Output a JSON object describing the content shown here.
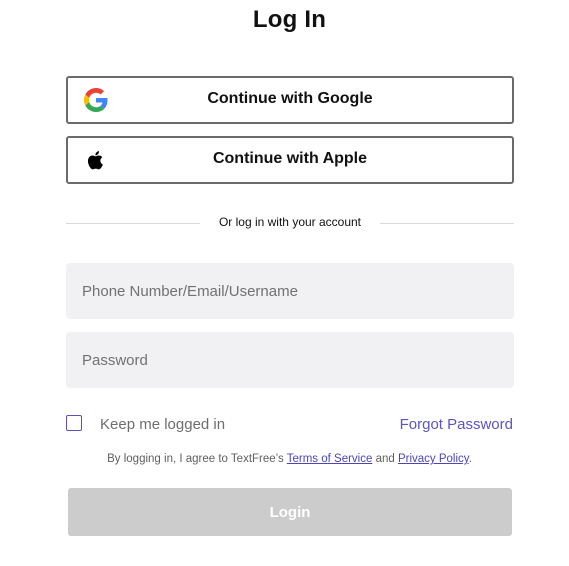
{
  "page": {
    "title": "Log In"
  },
  "social": {
    "google_label": "Continue with Google",
    "apple_label": "Continue with Apple",
    "google_icon": "google-g-icon",
    "apple_icon": "apple-logo-icon"
  },
  "divider": {
    "text": "Or log in with your account"
  },
  "form": {
    "phone_placeholder": "Phone Number/Email/Username",
    "phone_value": "",
    "password_placeholder": "Password",
    "password_value": "",
    "keep_logged_in_label": "Keep me logged in",
    "keep_logged_in_checked": false,
    "forgot_password_label": "Forgot Password"
  },
  "terms": {
    "prefix": "By logging in, I agree to TextFree’s ",
    "terms_link": "Terms of Service",
    "middle": " and ",
    "privacy_link": "Privacy Policy",
    "suffix": "."
  },
  "login_button": {
    "label": "Login"
  },
  "colors": {
    "accent": "#5c53c6",
    "login_disabled_bg": "#cccccc",
    "field_bg": "#f1f1f3",
    "border": "#6b6b6b"
  }
}
